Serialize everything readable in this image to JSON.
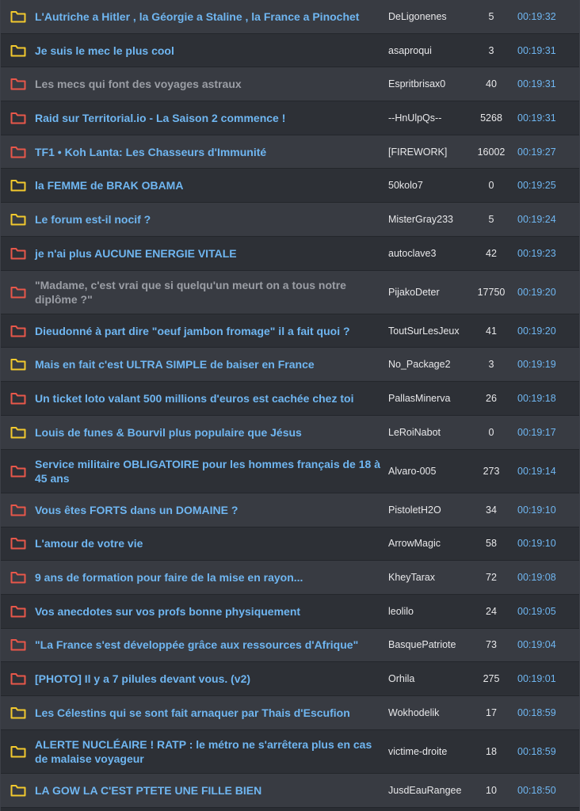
{
  "colors": {
    "folder_yellow": "#f2c92e",
    "folder_red": "#e8574a",
    "title_unread": "#6fb6f1",
    "title_read": "#9b9ea5",
    "row_even": "#383b42",
    "row_odd": "#2d3036"
  },
  "topics": [
    {
      "icon": "folder-yellow-icon",
      "title": "L'Autriche a Hitler , la Géorgie a Staline , la France a Pinochet",
      "author": "DeLigonenes",
      "replies": "5",
      "time": "00:19:32",
      "read": false
    },
    {
      "icon": "folder-yellow-icon",
      "title": "Je suis le mec le plus cool",
      "author": "asaproqui",
      "replies": "3",
      "time": "00:19:31",
      "read": false
    },
    {
      "icon": "folder-red-icon",
      "title": "Les mecs qui font des voyages astraux",
      "author": "Espritbrisax0",
      "replies": "40",
      "time": "00:19:31",
      "read": true
    },
    {
      "icon": "folder-red-icon",
      "title": "Raid sur Territorial.io - La Saison 2 commence !",
      "author": "--HnUlpQs--",
      "replies": "5268",
      "time": "00:19:31",
      "read": false
    },
    {
      "icon": "folder-red-icon",
      "title": "TF1 • Koh Lanta: Les Chasseurs d'Immunité",
      "author": "[FIREWORK]",
      "replies": "16002",
      "time": "00:19:27",
      "read": false
    },
    {
      "icon": "folder-yellow-icon",
      "title": "la FEMME de BRAK OBAMA",
      "author": "50kolo7",
      "replies": "0",
      "time": "00:19:25",
      "read": false
    },
    {
      "icon": "folder-yellow-icon",
      "title": "Le forum est-il nocif ?",
      "author": "MisterGray233",
      "replies": "5",
      "time": "00:19:24",
      "read": false
    },
    {
      "icon": "folder-red-icon",
      "title": "je n'ai plus AUCUNE ENERGIE VITALE",
      "author": "autoclave3",
      "replies": "42",
      "time": "00:19:23",
      "read": false
    },
    {
      "icon": "folder-red-icon",
      "title": "\"Madame, c'est vrai que si quelqu'un meurt on a tous notre diplôme ?\"",
      "author": "PijakoDeter",
      "replies": "17750",
      "time": "00:19:20",
      "read": true
    },
    {
      "icon": "folder-red-icon",
      "title": "Dieudonné à part dire \"oeuf jambon fromage\" il a fait quoi ?",
      "author": "ToutSurLesJeux",
      "replies": "41",
      "time": "00:19:20",
      "read": false
    },
    {
      "icon": "folder-yellow-icon",
      "title": "Mais en fait c'est ULTRA SIMPLE de baiser en France",
      "author": "No_Package2",
      "replies": "3",
      "time": "00:19:19",
      "read": false
    },
    {
      "icon": "folder-red-icon",
      "title": "Un ticket loto valant 500 millions d'euros est cachée chez toi",
      "author": "PallasMinerva",
      "replies": "26",
      "time": "00:19:18",
      "read": false
    },
    {
      "icon": "folder-yellow-icon",
      "title": "Louis de funes & Bourvil plus populaire que Jésus",
      "author": "LeRoiNabot",
      "replies": "0",
      "time": "00:19:17",
      "read": false
    },
    {
      "icon": "folder-red-icon",
      "title": "Service militaire OBLIGATOIRE pour les hommes français de 18 à 45 ans",
      "author": "Alvaro-005",
      "replies": "273",
      "time": "00:19:14",
      "read": false
    },
    {
      "icon": "folder-red-icon",
      "title": "Vous êtes FORTS dans un DOMAINE ?",
      "author": "PistoletH2O",
      "replies": "34",
      "time": "00:19:10",
      "read": false
    },
    {
      "icon": "folder-red-icon",
      "title": "L'amour de votre vie",
      "author": "ArrowMagic",
      "replies": "58",
      "time": "00:19:10",
      "read": false
    },
    {
      "icon": "folder-red-icon",
      "title": "9 ans de formation pour faire de la mise en rayon...",
      "author": "KheyTarax",
      "replies": "72",
      "time": "00:19:08",
      "read": false
    },
    {
      "icon": "folder-red-icon",
      "title": "Vos anecdotes sur vos profs bonne physiquement",
      "author": "leolilo",
      "replies": "24",
      "time": "00:19:05",
      "read": false
    },
    {
      "icon": "folder-red-icon",
      "title": "\"La France s'est développée grâce aux ressources d'Afrique\"",
      "author": "BasquePatriote",
      "replies": "73",
      "time": "00:19:04",
      "read": false
    },
    {
      "icon": "folder-red-icon",
      "title": "[PHOTO] Il y a 7 pilules devant vous. (v2)",
      "author": "Orhila",
      "replies": "275",
      "time": "00:19:01",
      "read": false
    },
    {
      "icon": "folder-yellow-icon",
      "title": "Les Célestins qui se sont fait arnaquer par Thais d'Escufion",
      "author": "Wokhodelik",
      "replies": "17",
      "time": "00:18:59",
      "read": false
    },
    {
      "icon": "folder-yellow-icon",
      "title": "ALERTE NUCLÉAIRE ! RATP : le métro ne s'arrêtera plus en cas de malaise voyageur",
      "author": "victime-droite",
      "replies": "18",
      "time": "00:18:59",
      "read": false
    },
    {
      "icon": "folder-yellow-icon",
      "title": "LA GOW LA C'EST PTETE UNE FILLE BIEN",
      "author": "JusdEauRangee",
      "replies": "10",
      "time": "00:18:50",
      "read": false
    }
  ]
}
